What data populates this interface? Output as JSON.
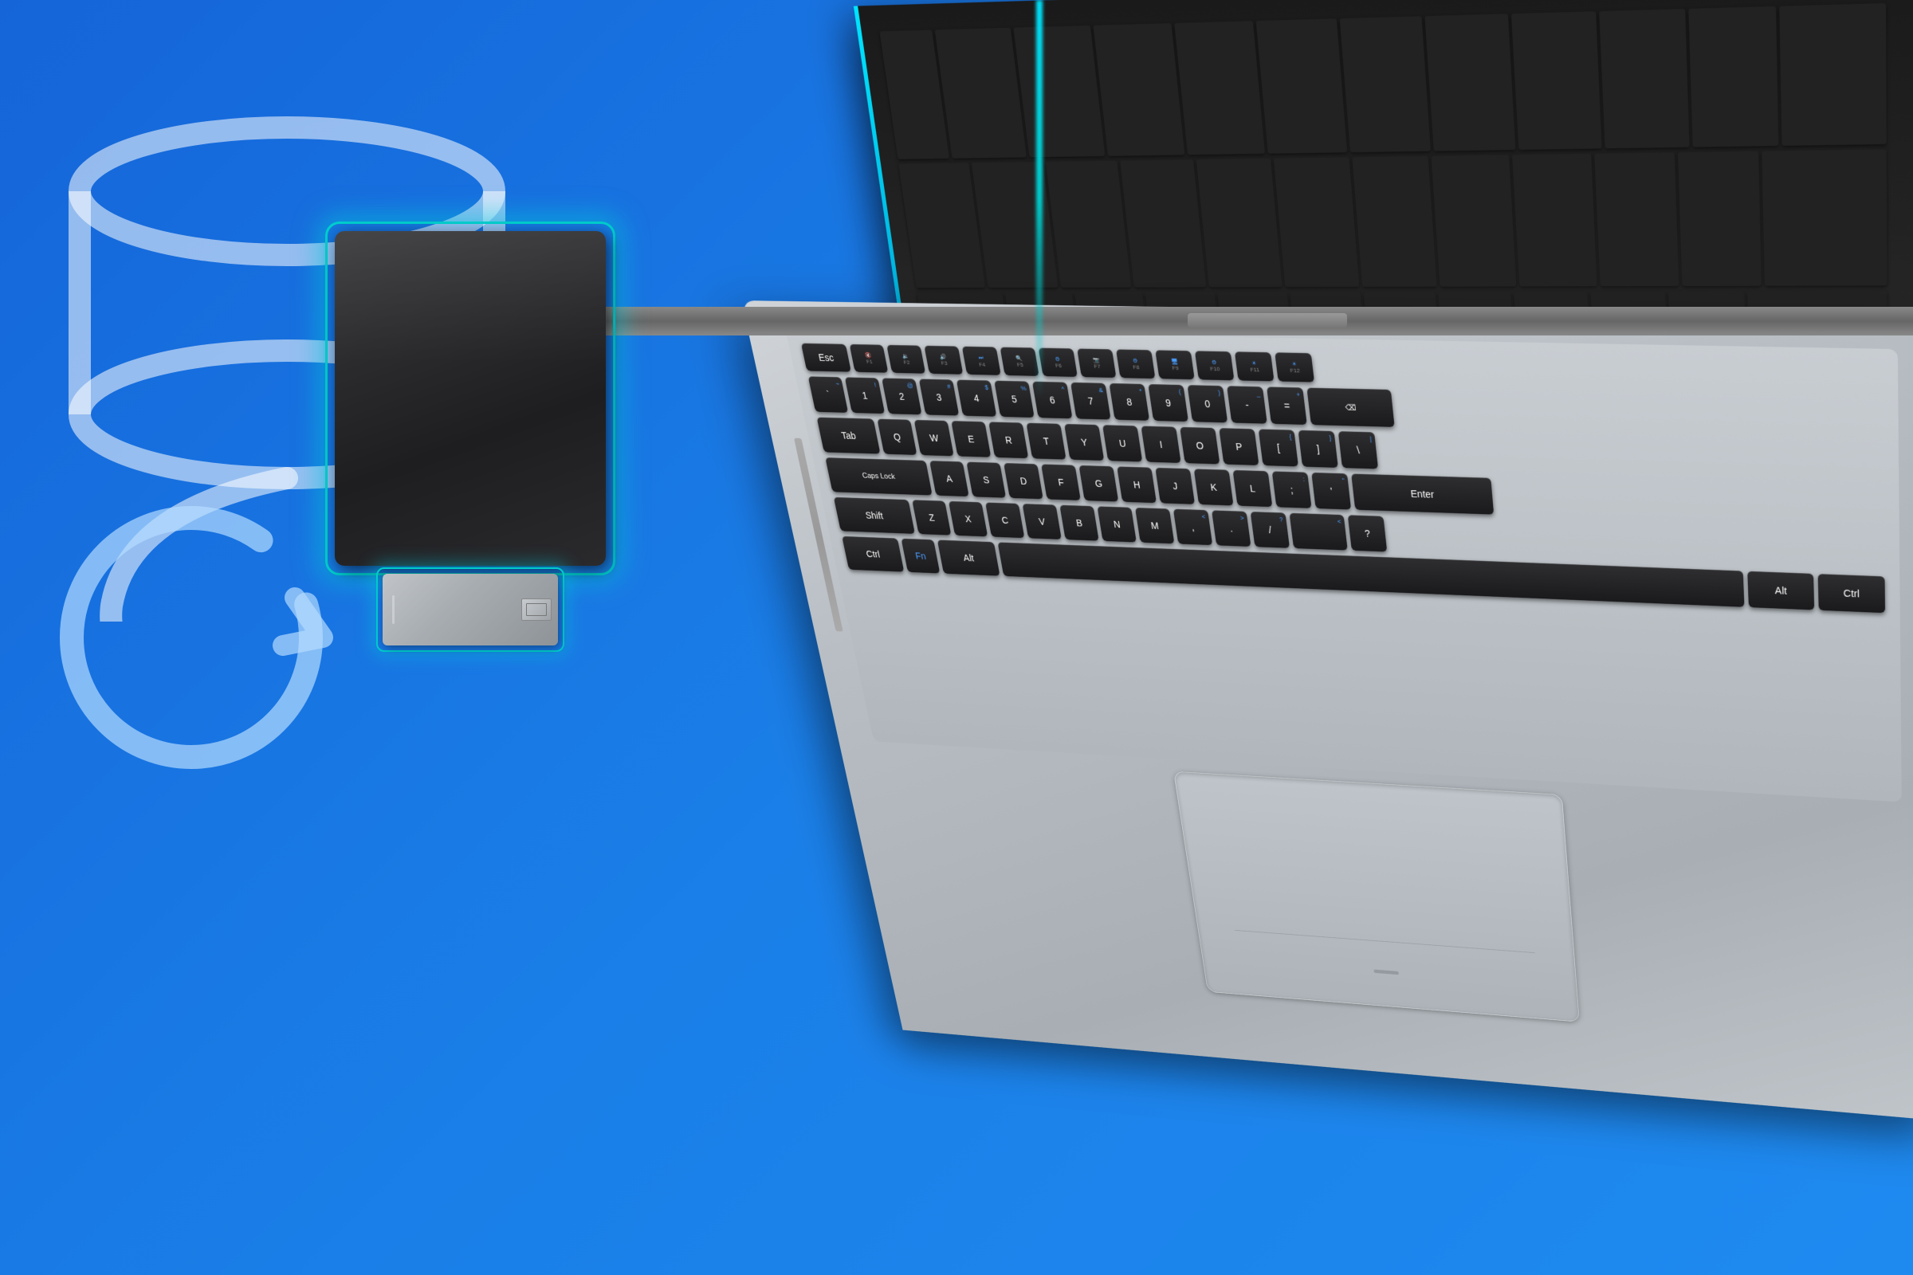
{
  "background": {
    "color": "#1a7fe8"
  },
  "keyboard": {
    "caps_lock_label": "Caps Lock",
    "rows": {
      "fn_row": [
        "Esc",
        "F1",
        "F2",
        "F3",
        "F4",
        "F5",
        "F6",
        "F7",
        "F8",
        "F9",
        "F10",
        "F11",
        "F12"
      ],
      "number_row": [
        "~`",
        "!1",
        "@2",
        "#3",
        "$4",
        "%5",
        "^6",
        "&7",
        "*8",
        "(9",
        ")0",
        "_-",
        "+=",
        "Backspace"
      ],
      "tab_row": [
        "Tab",
        "Q",
        "W",
        "E",
        "R",
        "T",
        "Y",
        "U",
        "I",
        "O",
        "P",
        "[{",
        "]}",
        "\\|"
      ],
      "caps_row": [
        "Caps Lock",
        "A",
        "S",
        "D",
        "F",
        "G",
        "H",
        "J",
        "K",
        "L",
        ":;",
        "'\"",
        "Enter"
      ],
      "shift_row": [
        "Shift",
        "Z",
        "X",
        "C",
        "V",
        "B",
        "N",
        "M",
        ",<",
        ".>",
        "/?",
        "Shift"
      ],
      "ctrl_row": [
        "Ctrl",
        "Fn",
        "Alt",
        "Space",
        "Alt",
        "Ctrl"
      ]
    }
  },
  "devices": {
    "external_hdd": {
      "label": "External HDD",
      "color": "#2a2a2d"
    },
    "usb_drive": {
      "label": "USB Drive",
      "color": "#b0b4b8"
    },
    "laptop": {
      "label": "Laptop",
      "color": "#c0c5ca"
    }
  },
  "icons": {
    "database": "database-icon",
    "refresh": "refresh-icon",
    "hdd": "hdd-icon",
    "usb": "usb-icon",
    "laptop": "laptop-icon"
  }
}
